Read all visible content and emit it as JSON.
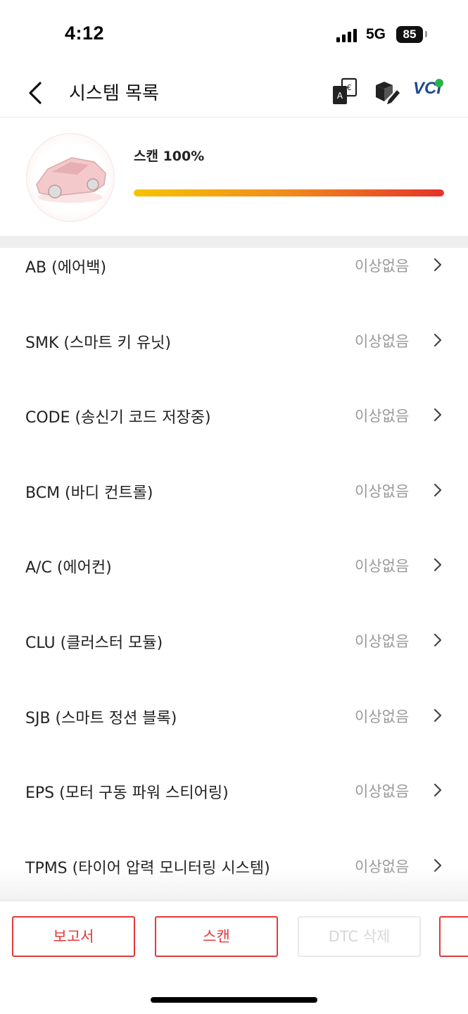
{
  "status_bar": {
    "time": "4:12",
    "network": "5G",
    "battery": "85"
  },
  "header": {
    "title": "시스템 목록",
    "icons": [
      "back-chevron-icon",
      "translate-icon",
      "box-edit-icon",
      "vci-connection-icon"
    ],
    "vci_label": "VCI"
  },
  "scan": {
    "label": "스캔 100%",
    "progress": 1.0
  },
  "systems": [
    {
      "name": "AB (에어백)",
      "status": "이상없음"
    },
    {
      "name": "SMK (스마트 키 유닛)",
      "status": "이상없음"
    },
    {
      "name": "CODE (송신기 코드 저장중)",
      "status": "이상없음"
    },
    {
      "name": "BCM (바디 컨트롤)",
      "status": "이상없음"
    },
    {
      "name": "A/C (에어컨)",
      "status": "이상없음"
    },
    {
      "name": "CLU (클러스터 모듈)",
      "status": "이상없음"
    },
    {
      "name": "SJB (스마트 정션 블록)",
      "status": "이상없음"
    },
    {
      "name": "EPS (모터 구동 파워 스티어링)",
      "status": "이상없음"
    },
    {
      "name": "TPMS (타이어 압력 모니터링 시스템)",
      "status": "이상없음"
    }
  ],
  "actions": {
    "report": "보고서",
    "scan": "스캔",
    "clear_dtc": "DTC 삭제"
  },
  "colors": {
    "accent": "#e03a3a",
    "vci": "#1f4a8c",
    "vci_dot": "#27b34a"
  }
}
